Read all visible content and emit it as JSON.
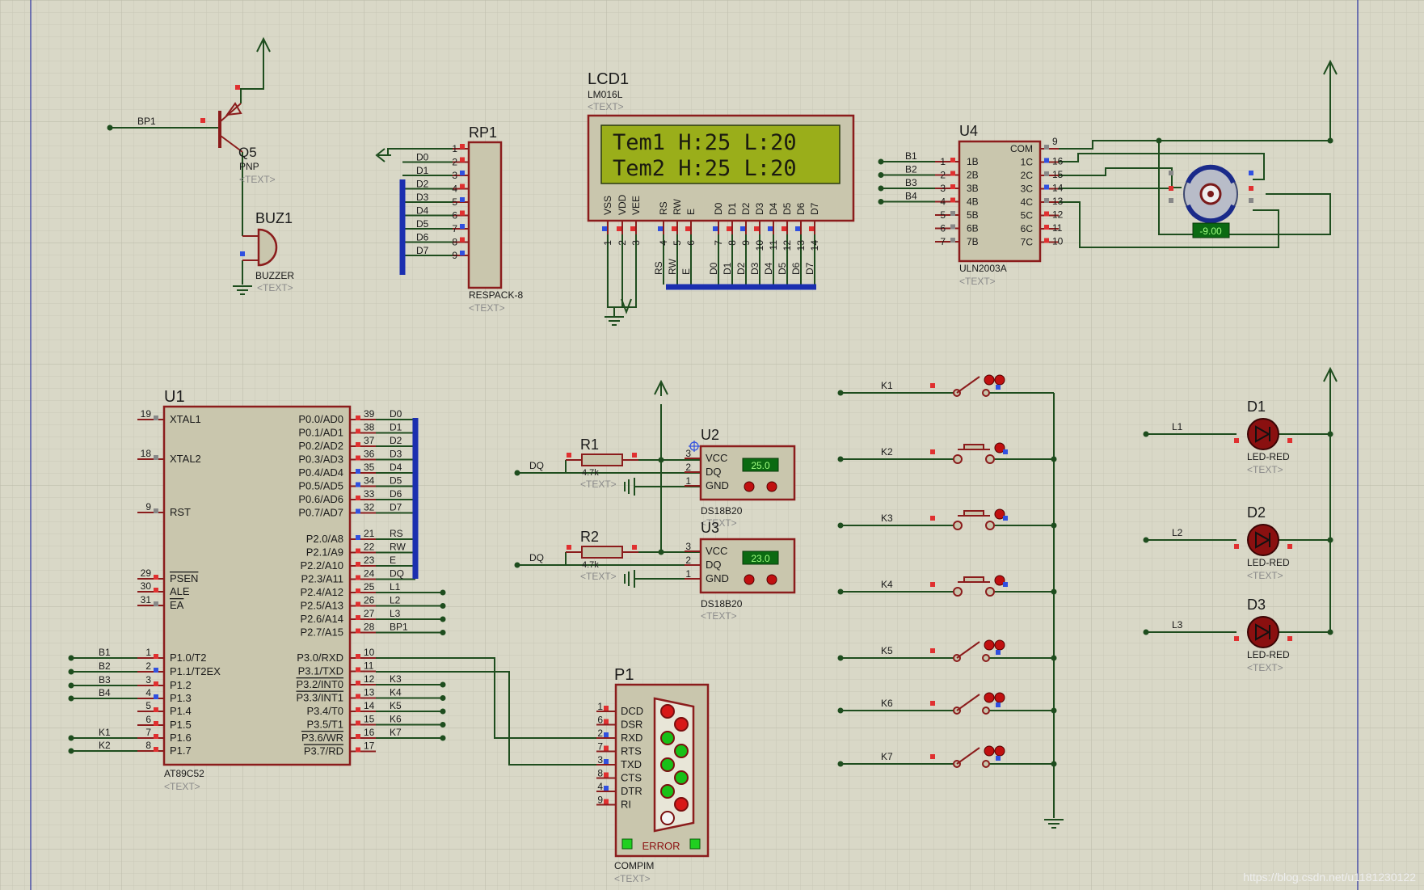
{
  "colors": {
    "background": "#d9d8c7",
    "grid": "#c9c8b7",
    "grid_major": "#bebdac",
    "wire": "#1e4d1e",
    "part_outline": "#8b1c1c",
    "part_fill": "#c9c6ad",
    "pin_red": "#e03030",
    "pin_blue": "#3050e0",
    "pin_gray": "#888888",
    "bus": "#1b2fb0",
    "lcd_screen": "#9aae1a",
    "led_red": "#d81818",
    "led_green": "#18c018",
    "text": "#1a1a1a",
    "placeholder": "#8a8a8a",
    "margin_line": "#2830a0"
  },
  "placeholder": "<TEXT>",
  "q5": {
    "ref": "Q5",
    "type": "PNP",
    "net": "BP1"
  },
  "buz1": {
    "ref": "BUZ1",
    "type": "BUZZER"
  },
  "rp1": {
    "ref": "RP1",
    "type": "RESPACK-8",
    "pin_nums": [
      "1",
      "2",
      "3",
      "4",
      "5",
      "6",
      "7",
      "8",
      "9"
    ],
    "nets": [
      "D0",
      "D1",
      "D2",
      "D3",
      "D4",
      "D5",
      "D6",
      "D7"
    ]
  },
  "lcd1": {
    "ref": "LCD1",
    "type": "LM016L",
    "line1": "Tem1 H:25 L:20",
    "line2": "Tem2 H:25 L:20",
    "pins": [
      {
        "name": "VSS",
        "num": "1"
      },
      {
        "name": "VDD",
        "num": "2"
      },
      {
        "name": "VEE",
        "num": "3"
      },
      {
        "name": "RS",
        "num": "4"
      },
      {
        "name": "RW",
        "num": "5"
      },
      {
        "name": "E",
        "num": "6"
      },
      {
        "name": "D0",
        "num": "7"
      },
      {
        "name": "D1",
        "num": "8"
      },
      {
        "name": "D2",
        "num": "9"
      },
      {
        "name": "D3",
        "num": "10"
      },
      {
        "name": "D4",
        "num": "11"
      },
      {
        "name": "D5",
        "num": "12"
      },
      {
        "name": "D6",
        "num": "13"
      },
      {
        "name": "D7",
        "num": "14"
      }
    ],
    "bus_labels": [
      "RS",
      "RW",
      "E",
      "D0",
      "D1",
      "D2",
      "D3",
      "D4",
      "D5",
      "D6",
      "D7"
    ]
  },
  "u4": {
    "ref": "U4",
    "type": "ULN2003A",
    "left_pins": [
      {
        "num": "1",
        "name": "1B",
        "net": "B1"
      },
      {
        "num": "2",
        "name": "2B",
        "net": "B2"
      },
      {
        "num": "3",
        "name": "3B",
        "net": "B3"
      },
      {
        "num": "4",
        "name": "4B",
        "net": "B4"
      },
      {
        "num": "5",
        "name": "5B",
        "net": ""
      },
      {
        "num": "6",
        "name": "6B",
        "net": ""
      },
      {
        "num": "7",
        "name": "7B",
        "net": ""
      }
    ],
    "right_pins": [
      {
        "num": "9",
        "name": "COM"
      },
      {
        "num": "16",
        "name": "1C"
      },
      {
        "num": "15",
        "name": "2C"
      },
      {
        "num": "14",
        "name": "3C"
      },
      {
        "num": "13",
        "name": "4C"
      },
      {
        "num": "12",
        "name": "5C"
      },
      {
        "num": "11",
        "name": "6C"
      },
      {
        "num": "10",
        "name": "7C"
      }
    ]
  },
  "motor": {
    "readout": "-9.00"
  },
  "u1": {
    "ref": "U1",
    "type": "AT89C52",
    "left_pins": [
      {
        "num": "19",
        "name": "XTAL1",
        "net": ""
      },
      {
        "num": "18",
        "name": "XTAL2",
        "net": ""
      },
      {
        "num": "9",
        "name": "RST",
        "net": ""
      },
      {
        "num": "29",
        "name": "PSEN",
        "net": "",
        "bar": true
      },
      {
        "num": "30",
        "name": "ALE",
        "net": ""
      },
      {
        "num": "31",
        "name": "EA",
        "net": "",
        "bar": true
      },
      {
        "num": "1",
        "name": "P1.0/T2",
        "net": "B1"
      },
      {
        "num": "2",
        "name": "P1.1/T2EX",
        "net": "B2"
      },
      {
        "num": "3",
        "name": "P1.2",
        "net": "B3"
      },
      {
        "num": "4",
        "name": "P1.3",
        "net": "B4"
      },
      {
        "num": "5",
        "name": "P1.4",
        "net": ""
      },
      {
        "num": "6",
        "name": "P1.5",
        "net": ""
      },
      {
        "num": "7",
        "name": "P1.6",
        "net": "K1"
      },
      {
        "num": "8",
        "name": "P1.7",
        "net": "K2"
      }
    ],
    "right_pins": [
      {
        "num": "39",
        "name": "P0.0/AD0",
        "net": "D0"
      },
      {
        "num": "38",
        "name": "P0.1/AD1",
        "net": "D1"
      },
      {
        "num": "37",
        "name": "P0.2/AD2",
        "net": "D2"
      },
      {
        "num": "36",
        "name": "P0.3/AD3",
        "net": "D3"
      },
      {
        "num": "35",
        "name": "P0.4/AD4",
        "net": "D4"
      },
      {
        "num": "34",
        "name": "P0.5/AD5",
        "net": "D5"
      },
      {
        "num": "33",
        "name": "P0.6/AD6",
        "net": "D6"
      },
      {
        "num": "32",
        "name": "P0.7/AD7",
        "net": "D7"
      },
      {
        "num": "21",
        "name": "P2.0/A8",
        "net": "RS"
      },
      {
        "num": "22",
        "name": "P2.1/A9",
        "net": "RW"
      },
      {
        "num": "23",
        "name": "P2.2/A10",
        "net": "E"
      },
      {
        "num": "24",
        "name": "P2.3/A11",
        "net": "DQ"
      },
      {
        "num": "25",
        "name": "P2.4/A12",
        "net": "L1"
      },
      {
        "num": "26",
        "name": "P2.5/A13",
        "net": "L2"
      },
      {
        "num": "27",
        "name": "P2.6/A14",
        "net": "L3"
      },
      {
        "num": "28",
        "name": "P2.7/A15",
        "net": "BP1"
      },
      {
        "num": "10",
        "name": "P3.0/RXD",
        "net": ""
      },
      {
        "num": "11",
        "name": "P3.1/TXD",
        "net": ""
      },
      {
        "num": "12",
        "name": "P3.2/INT0",
        "net": "K3",
        "bar": true
      },
      {
        "num": "13",
        "name": "P3.3/INT1",
        "net": "K4",
        "bar": true
      },
      {
        "num": "14",
        "name": "P3.4/T0",
        "net": "K5"
      },
      {
        "num": "15",
        "name": "P3.5/T1",
        "net": "K6"
      },
      {
        "num": "16",
        "name": "P3.6/WR",
        "net": "K7",
        "bar": true
      },
      {
        "num": "17",
        "name": "P3.7/RD",
        "net": "",
        "bar": true
      }
    ]
  },
  "r1": {
    "ref": "R1",
    "value": "4.7k",
    "net": "DQ"
  },
  "r2": {
    "ref": "R2",
    "value": "4.7k",
    "net": "DQ"
  },
  "u2": {
    "ref": "U2",
    "type": "DS18B20",
    "reading": "25.0",
    "pins": [
      {
        "num": "3",
        "name": "VCC"
      },
      {
        "num": "2",
        "name": "DQ"
      },
      {
        "num": "1",
        "name": "GND"
      }
    ]
  },
  "u3": {
    "ref": "U3",
    "type": "DS18B20",
    "reading": "23.0",
    "pins": [
      {
        "num": "3",
        "name": "VCC"
      },
      {
        "num": "2",
        "name": "DQ"
      },
      {
        "num": "1",
        "name": "GND"
      }
    ]
  },
  "p1": {
    "ref": "P1",
    "type": "COMPIM",
    "status": "ERROR",
    "pins": [
      {
        "num": "1",
        "name": "DCD"
      },
      {
        "num": "6",
        "name": "DSR"
      },
      {
        "num": "2",
        "name": "RXD"
      },
      {
        "num": "7",
        "name": "RTS"
      },
      {
        "num": "3",
        "name": "TXD"
      },
      {
        "num": "8",
        "name": "CTS"
      },
      {
        "num": "4",
        "name": "DTR"
      },
      {
        "num": "9",
        "name": "RI"
      }
    ]
  },
  "switches": [
    {
      "label": "K1",
      "kind": "toggle"
    },
    {
      "label": "K2",
      "kind": "button"
    },
    {
      "label": "K3",
      "kind": "button"
    },
    {
      "label": "K4",
      "kind": "button"
    },
    {
      "label": "K5",
      "kind": "toggle"
    },
    {
      "label": "K6",
      "kind": "toggle"
    },
    {
      "label": "K7",
      "kind": "toggle"
    }
  ],
  "leds": [
    {
      "ref": "D1",
      "type": "LED-RED",
      "net": "L1"
    },
    {
      "ref": "D2",
      "type": "LED-RED",
      "net": "L2"
    },
    {
      "ref": "D3",
      "type": "LED-RED",
      "net": "L3"
    }
  ],
  "watermark": "https://blog.csdn.net/u1181230122"
}
